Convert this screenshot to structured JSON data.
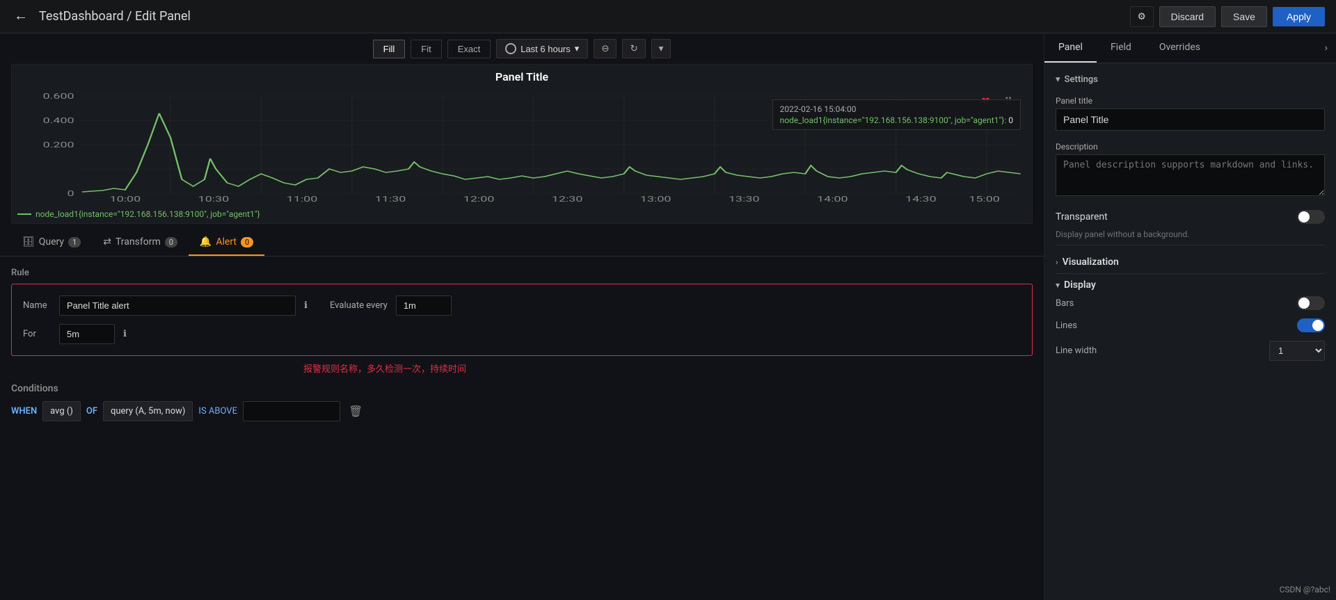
{
  "header": {
    "back_label": "←",
    "breadcrumb": "TestDashboard / Edit Panel",
    "gear_icon": "⚙",
    "discard_label": "Discard",
    "save_label": "Save",
    "apply_label": "Apply"
  },
  "chart_toolbar": {
    "fill_label": "Fill",
    "fit_label": "Fit",
    "exact_label": "Exact",
    "time_range": "Last 6 hours",
    "zoom_icon": "⊖",
    "refresh_icon": "↻",
    "more_icon": "▾"
  },
  "chart": {
    "title": "Panel Title",
    "y_labels": [
      "0.600",
      "0.400",
      "0.200",
      "0"
    ],
    "x_labels": [
      "10:00",
      "10:30",
      "11:00",
      "11:30",
      "12:00",
      "12:30",
      "13:00",
      "13:30",
      "14:00",
      "14:30",
      "15:00"
    ],
    "legend": "node_load1{instance=\"192.168.156.138:9100\", job=\"agent1\"}",
    "tooltip_time": "2022-02-16 15:04:00",
    "tooltip_metric": "node_load1{instance=\"192.168.156.138:9100\", job=\"agent1\"}:",
    "tooltip_value": "0"
  },
  "bottom_tabs": [
    {
      "label": "Query",
      "badge": "1",
      "icon": "🗄"
    },
    {
      "label": "Transform",
      "badge": "0",
      "icon": "⇄"
    },
    {
      "label": "Alert",
      "badge": "0",
      "icon": "🔔"
    }
  ],
  "alert_section": {
    "rule_section": {
      "title": "Rule",
      "name_label": "Name",
      "name_value": "Panel Title alert",
      "info_icon": "ℹ",
      "eval_label": "Evaluate every",
      "eval_value": "1m",
      "for_label": "For",
      "for_value": "5m"
    },
    "annotation": "报警规则名称，多久检测一次，持续时间",
    "conditions": {
      "title": "Conditions",
      "when_label": "WHEN",
      "func": "avg ()",
      "of_label": "OF",
      "query": "query (A, 5m, now)",
      "above_label": "IS ABOVE",
      "value": ""
    }
  },
  "right_panel": {
    "tabs": [
      "Panel",
      "Field",
      "Overrides"
    ],
    "active_tab": "Panel",
    "settings": {
      "title": "Settings",
      "panel_title_label": "Panel title",
      "panel_title_value": "Panel Title",
      "description_label": "Description",
      "description_placeholder": "Panel description supports markdown and links.",
      "transparent_label": "Transparent",
      "transparent_desc": "Display panel without a background.",
      "transparent_on": false
    },
    "visualization": {
      "title": "Visualization"
    },
    "display": {
      "title": "Display",
      "bars_label": "Bars",
      "bars_on": false,
      "lines_label": "Lines",
      "lines_on": true,
      "line_width_label": "Line width",
      "line_width_value": "1"
    }
  },
  "watermark": "CSDN @?abc!"
}
